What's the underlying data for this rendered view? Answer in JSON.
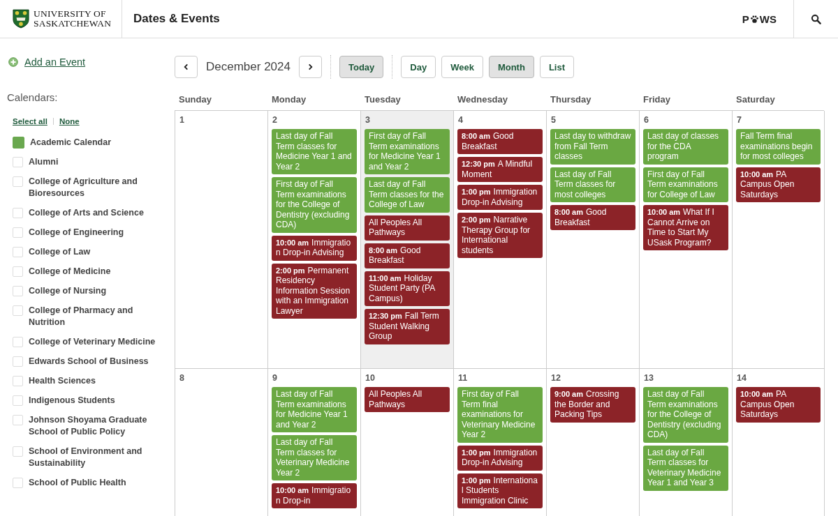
{
  "header": {
    "logo": [
      "UNIVERSITY OF",
      "SASKATCHEWAN"
    ],
    "title": "Dates & Events",
    "paws": [
      "P",
      "WS"
    ]
  },
  "sidebar": {
    "add_event": "Add an Event",
    "calendars_heading": "Calendars:",
    "select_all": "Select all",
    "select_none": "None",
    "calendars": [
      {
        "label": "Academic Calendar",
        "checked": true
      },
      {
        "label": "Alumni",
        "checked": false
      },
      {
        "label": "College of Agriculture and Bioresources",
        "checked": false
      },
      {
        "label": "College of Arts and Science",
        "checked": false
      },
      {
        "label": "College of Engineering",
        "checked": false
      },
      {
        "label": "College of Law",
        "checked": false
      },
      {
        "label": "College of Medicine",
        "checked": false
      },
      {
        "label": "College of Nursing",
        "checked": false
      },
      {
        "label": "College of Pharmacy and Nutrition",
        "checked": false
      },
      {
        "label": "College of Veterinary Medicine",
        "checked": false
      },
      {
        "label": "Edwards School of Business",
        "checked": false
      },
      {
        "label": "Health Sciences",
        "checked": false
      },
      {
        "label": "Indigenous Students",
        "checked": false
      },
      {
        "label": "Johnson Shoyama Graduate School of Public Policy",
        "checked": false
      },
      {
        "label": "School of Environment and Sustainability",
        "checked": false
      },
      {
        "label": "School of Public Health",
        "checked": false
      }
    ]
  },
  "toolbar": {
    "month": "December 2024",
    "today": {
      "label": "Today",
      "disabled": true
    },
    "views": [
      {
        "label": "Day",
        "selected": false
      },
      {
        "label": "Week",
        "selected": false
      },
      {
        "label": "Month",
        "selected": true
      },
      {
        "label": "List",
        "selected": false
      }
    ]
  },
  "weekdays": [
    "Sunday",
    "Monday",
    "Tuesday",
    "Wednesday",
    "Thursday",
    "Friday",
    "Saturday"
  ],
  "weeks": [
    [
      {
        "date": "1",
        "today": false
      },
      {
        "date": "2",
        "today": false,
        "events": [
          {
            "kind": "academic",
            "text": "Last day of Fall Term classes for Medicine Year 1 and Year 2"
          },
          {
            "kind": "academic",
            "text": "First day of Fall Term examinations for the College of Dentistry (excluding CDA)"
          },
          {
            "kind": "event",
            "time": "10:00 am",
            "text": "Immigration Drop-in Advising"
          },
          {
            "kind": "event",
            "time": "2:00 pm",
            "text": "Permanent Residency Information Session with an Immigration Lawyer"
          }
        ]
      },
      {
        "date": "3",
        "today": true,
        "events": [
          {
            "kind": "academic",
            "text": "First day of Fall Term examinations for Medicine Year 1 and Year 2"
          },
          {
            "kind": "academic",
            "text": "Last day of Fall Term classes for the College of Law"
          },
          {
            "kind": "event",
            "text": "All Peoples All Pathways"
          },
          {
            "kind": "event",
            "time": "8:00 am",
            "text": "Good Breakfast"
          },
          {
            "kind": "event",
            "time": "11:00 am",
            "text": "Holiday Student Party (PA Campus)"
          },
          {
            "kind": "event",
            "time": "12:30 pm",
            "text": "Fall Term Student Walking Group"
          }
        ]
      },
      {
        "date": "4",
        "today": false,
        "events": [
          {
            "kind": "event",
            "time": "8:00 am",
            "text": "Good Breakfast"
          },
          {
            "kind": "event",
            "time": "12:30 pm",
            "text": "A Mindful Moment"
          },
          {
            "kind": "event",
            "time": "1:00 pm",
            "text": "Immigration Drop-in Advising"
          },
          {
            "kind": "event",
            "time": "2:00 pm",
            "text": "Narrative Therapy Group for International students"
          }
        ]
      },
      {
        "date": "5",
        "today": false,
        "events": [
          {
            "kind": "academic",
            "text": "Last day to withdraw from Fall Term classes"
          },
          {
            "kind": "academic",
            "text": "Last day of Fall Term classes for most colleges"
          },
          {
            "kind": "event",
            "time": "8:00 am",
            "text": "Good Breakfast"
          }
        ]
      },
      {
        "date": "6",
        "today": false,
        "events": [
          {
            "kind": "academic",
            "text": "Last day of classes for the CDA program"
          },
          {
            "kind": "academic",
            "text": "First day of Fall Term examinations for College of Law"
          },
          {
            "kind": "event",
            "time": "10:00 am",
            "text": "What If I Cannot Arrive on Time to Start My USask Program?"
          }
        ]
      },
      {
        "date": "7",
        "today": false,
        "events": [
          {
            "kind": "academic",
            "text": "Fall Term final examinations begin for most colleges"
          },
          {
            "kind": "event",
            "time": "10:00 am",
            "text": "PA Campus Open Saturdays"
          }
        ]
      }
    ],
    [
      {
        "date": "8",
        "today": false
      },
      {
        "date": "9",
        "today": false,
        "events": [
          {
            "kind": "academic",
            "text": "Last day of Fall Term examinations for Medicine Year 1 and Year 2"
          },
          {
            "kind": "academic",
            "text": "Last day of Fall Term classes for Veterinary Medicine Year 2"
          },
          {
            "kind": "event",
            "time": "10:00 am",
            "text": "Immigration Drop-in"
          }
        ]
      },
      {
        "date": "10",
        "today": false,
        "events": [
          {
            "kind": "event",
            "text": "All Peoples All Pathways"
          }
        ]
      },
      {
        "date": "11",
        "today": false,
        "events": [
          {
            "kind": "academic",
            "text": "First day of Fall Term final examinations for Veterinary Medicine Year 2"
          },
          {
            "kind": "event",
            "time": "1:00 pm",
            "text": "Immigration Drop-in Advising"
          },
          {
            "kind": "event",
            "time": "1:00 pm",
            "text": "International Students Immigration Clinic"
          }
        ]
      },
      {
        "date": "12",
        "today": false,
        "events": [
          {
            "kind": "event",
            "time": "9:00 am",
            "text": "Crossing the Border and Packing Tips"
          }
        ]
      },
      {
        "date": "13",
        "today": false,
        "events": [
          {
            "kind": "academic",
            "text": "Last day of Fall Term examinations for the College of Dentistry (excluding CDA)"
          },
          {
            "kind": "academic",
            "text": "Last day of Fall Term classes for Veterinary Medicine Year 1 and Year 3"
          }
        ]
      },
      {
        "date": "14",
        "today": false,
        "events": [
          {
            "kind": "event",
            "time": "10:00 am",
            "text": "PA Campus Open Saturdays"
          }
        ]
      }
    ]
  ]
}
